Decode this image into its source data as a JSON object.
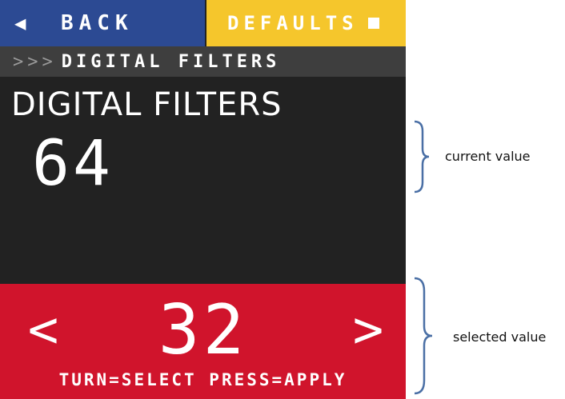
{
  "topbar": {
    "back_label": "BACK",
    "back_icon": "left-arrow-icon",
    "defaults_label": "DEFAULTS",
    "defaults_icon": "square-icon"
  },
  "breadcrumb": {
    "chevrons": ">>>",
    "label": "DIGITAL FILTERS"
  },
  "screen": {
    "title": "DIGITAL FILTERS",
    "current_value": "64"
  },
  "selector": {
    "prev_glyph": "<",
    "next_glyph": ">",
    "selected_value": "32",
    "hint": "TURN=SELECT PRESS=APPLY"
  },
  "annotations": {
    "current": "current value",
    "selected": "selected value"
  },
  "colors": {
    "back_bg": "#2c4a93",
    "defaults_bg": "#f5c62c",
    "screen_bg": "#222222",
    "selector_bg": "#d0142c",
    "brace": "#4a6fa5"
  }
}
